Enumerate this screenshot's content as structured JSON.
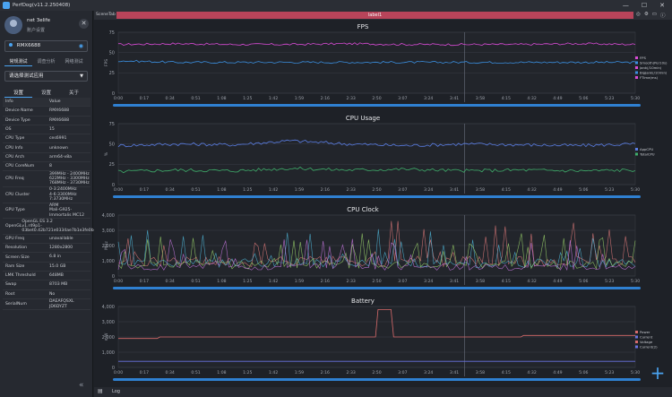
{
  "window": {
    "title": "PerfDog(v11.2.250408)",
    "controls": [
      "—",
      "☐",
      "✕"
    ]
  },
  "user": {
    "name": "net 3elife",
    "subtitle": "账户设置"
  },
  "device": {
    "name": "RMX6688"
  },
  "mode_tabs": [
    "常规测试",
    "调查分析",
    "网络测试"
  ],
  "app_select": {
    "placeholder": "请选择测试应用"
  },
  "settings_tabs": [
    "设置",
    "设置",
    "关于"
  ],
  "info": {
    "header": {
      "k": "Info",
      "v": "Value"
    },
    "rows": [
      {
        "k": "Device Name",
        "v": "RMX6688"
      },
      {
        "k": "Device Type",
        "v": "RMX6688"
      },
      {
        "k": "OS",
        "v": "15"
      },
      {
        "k": "CPU Type",
        "v": "ces6991"
      },
      {
        "k": "CPU Info",
        "v": "unknown"
      },
      {
        "k": "CPU Arch",
        "v": "arm64-v8a"
      },
      {
        "k": "CPU CoreNum",
        "v": "8"
      },
      {
        "k": "CPU Freq",
        "v": "399MHz - 2400MHz\n622MHz - 3300MHz\n768MHz - 3730MHz"
      },
      {
        "k": "CPU Cluster",
        "v": "0-3:2400MHz\n4-6:3300MHz\n7:3730MHz"
      },
      {
        "k": "GPU Type",
        "v": "ARM\nMali-G925-Immortalis MC12"
      },
      {
        "k": "OpenGL",
        "v": "OpenGL ES 3.2\nv1.r49p1-03bet0.42b721e0334ae7b1e3fe0bcaab94869d"
      },
      {
        "k": "GPU Freq",
        "v": "unavailable"
      },
      {
        "k": "Resolution",
        "v": "1280x2800"
      },
      {
        "k": "Screen Size",
        "v": "6.8 in"
      },
      {
        "k": "Ram Size",
        "v": "15.0 GB"
      },
      {
        "k": "LMK Threshold",
        "v": "648MB"
      },
      {
        "k": "Swap",
        "v": "8703 MB"
      },
      {
        "k": "Root",
        "v": "No"
      },
      {
        "k": "SerialNum",
        "v": "DAEAFQSXL JD6DYZT"
      }
    ]
  },
  "scene": {
    "tab": "SceneTab",
    "label": "label1"
  },
  "bottom": {
    "log": "Log"
  },
  "charts": [
    {
      "title": "FPS",
      "y_ticks": [
        "0",
        "25",
        "50",
        "75"
      ],
      "y_unit": "FPS"
    },
    {
      "title": "CPU Usage",
      "y_ticks": [
        "0",
        "25",
        "50",
        "75"
      ],
      "y_unit": "%"
    },
    {
      "title": "CPU Clock",
      "y_ticks": [
        "0",
        "1,000",
        "2,000",
        "3,000",
        "4,000"
      ],
      "y_unit": "MHz"
    },
    {
      "title": "Battery",
      "y_ticks": [
        "0",
        "1,000",
        "2,000",
        "3,000",
        "4,000"
      ],
      "y_unit": "mW"
    }
  ],
  "x_ticks": [
    "0:00",
    "0:17",
    "0:34",
    "0:51",
    "1:08",
    "1:25",
    "1:42",
    "1:59",
    "2:16",
    "2:33",
    "2:50",
    "3:07",
    "3:24",
    "3:41",
    "3:58",
    "4:15",
    "4:32",
    "4:49",
    "5:06",
    "5:23",
    "5:30"
  ],
  "fps_legend": [
    "FPS",
    "Smooth(Per10s)",
    "Jank(/10min)",
    "BigJank(/10min)",
    "FTime(ms)"
  ],
  "cpu_legend": [
    "AppCPU",
    "TotalCPU"
  ],
  "battery_legend": [
    "Power",
    "Current",
    "Voltage",
    "Current(2)"
  ],
  "chart_data": [
    {
      "type": "line",
      "title": "FPS",
      "x_range": [
        "0:00",
        "5:30"
      ],
      "ylim": [
        0,
        75
      ],
      "series": [
        {
          "name": "FPS",
          "values": [
            60,
            61,
            60,
            60,
            61,
            60,
            60,
            60,
            61,
            60
          ]
        },
        {
          "name": "Smooth(Per10s)",
          "values": [
            40,
            38,
            38,
            38,
            38,
            38,
            38,
            38,
            38,
            38
          ]
        }
      ]
    },
    {
      "type": "line",
      "title": "CPU Usage",
      "x_range": [
        "0:00",
        "5:30"
      ],
      "ylim": [
        0,
        75
      ],
      "series": [
        {
          "name": "TotalCPU",
          "values": [
            48,
            50,
            49,
            54,
            50,
            48,
            50,
            49,
            48,
            50
          ]
        },
        {
          "name": "AppCPU",
          "values": [
            16,
            18,
            17,
            20,
            18,
            19,
            17,
            18,
            17,
            18
          ]
        }
      ]
    },
    {
      "type": "line",
      "title": "CPU Clock",
      "x_range": [
        "0:00",
        "5:30"
      ],
      "ylim": [
        0,
        4000
      ],
      "series": [
        {
          "name": "Clock",
          "values": [
            800,
            1500,
            900,
            2400,
            700,
            3200,
            1100,
            2000,
            900,
            2600
          ]
        }
      ]
    },
    {
      "type": "line",
      "title": "Battery",
      "x_range": [
        "0:00",
        "5:30"
      ],
      "ylim": [
        0,
        4000
      ],
      "series": [
        {
          "name": "Power",
          "values": [
            2000,
            1900,
            1900,
            1950,
            1900,
            1950,
            3800,
            1900,
            1950,
            2050
          ]
        },
        {
          "name": "Voltage",
          "values": [
            400,
            400,
            400,
            400,
            400,
            400,
            400,
            400,
            400,
            400
          ]
        }
      ]
    }
  ]
}
